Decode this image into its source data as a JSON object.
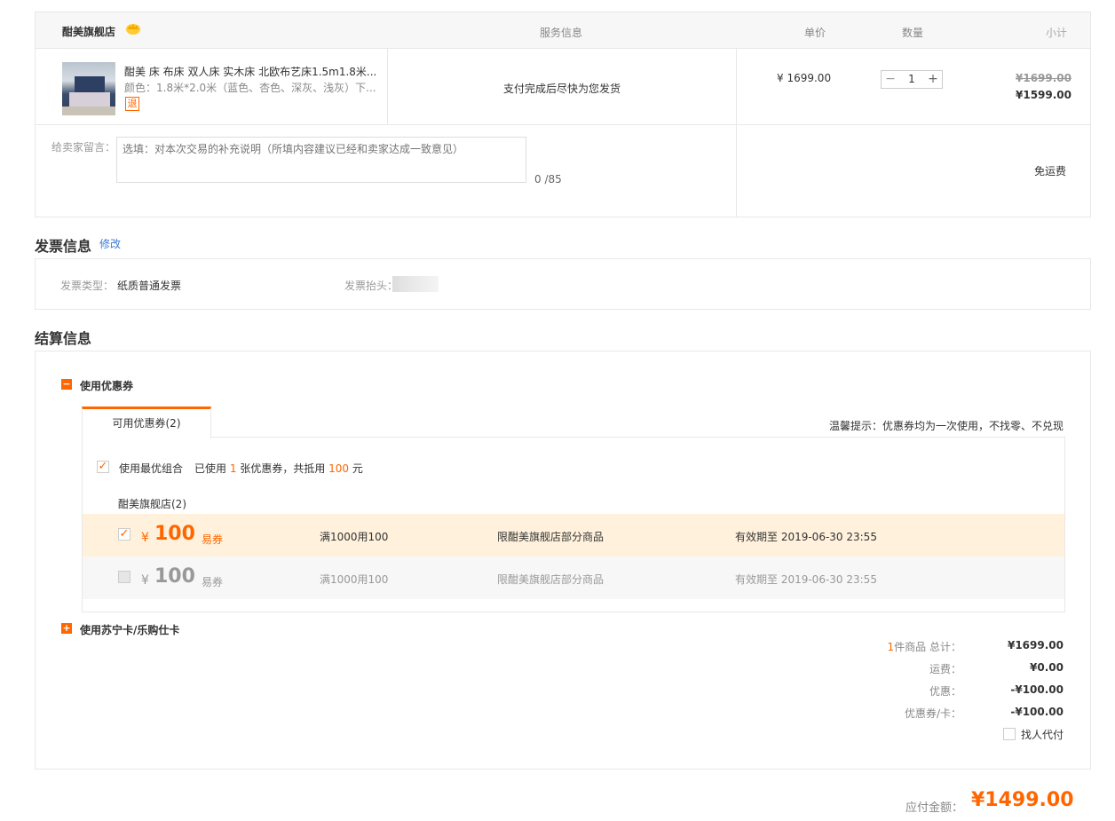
{
  "order": {
    "shop_name": "酣美旗舰店",
    "headers": {
      "service": "服务信息",
      "unit_price": "单价",
      "quantity": "数量",
      "subtotal": "小计"
    },
    "product": {
      "title": "酣美 床 布床 双人床 实木床 北欧布艺床1.5m1.8米...",
      "spec": "颜色：1.8米*2.0米（蓝色、杏色、深灰、浅灰）下...",
      "refund_tag": "退",
      "service": "支付完成后尽快为您发货",
      "unit_price": "¥ 1699.00",
      "quantity": "1",
      "original_subtotal": "¥1699.00",
      "subtotal": "¥1599.00"
    },
    "message_label": "给卖家留言：",
    "message_placeholder": "选填：对本次交易的补充说明（所填内容建议已经和卖家达成一致意见）",
    "message_count": "0 /85",
    "shipping": "免运费",
    "minus": "−",
    "plus": "+"
  },
  "invoice": {
    "title": "发票信息",
    "edit_link": "修改",
    "type_label": "发票类型：",
    "type_value": "纸质普通发票",
    "header_label": "发票抬头："
  },
  "settlement": {
    "title": "结算信息",
    "use_coupon": "使用优惠券",
    "tab_label": "可用优惠券(2)",
    "tip": "温馨提示：优惠券均为一次使用，不找零、不兑现",
    "best_combo": "使用最优组合",
    "used_prefix": "已使用",
    "used_count": "1",
    "used_mid": "张优惠券，共抵用",
    "used_amount": "100",
    "used_suffix": "元",
    "store_group": "酣美旗舰店(2)",
    "coupons": [
      {
        "currency": "¥",
        "amount": "100",
        "type": "易券",
        "rule": "满1000用100",
        "scope": "限酣美旗舰店部分商品",
        "expiry": "有效期至 2019-06-30 23:55",
        "checked": true
      },
      {
        "currency": "¥",
        "amount": "100",
        "type": "易券",
        "rule": "满1000用100",
        "scope": "限酣美旗舰店部分商品",
        "expiry": "有效期至 2019-06-30 23:55",
        "checked": false
      }
    ],
    "use_card": "使用苏宁卡/乐购仕卡",
    "summary": {
      "count": "1",
      "items_label": "件商品  总计：",
      "total": "¥1699.00",
      "shipping_label": "运费：",
      "shipping": "¥0.00",
      "discount_label": "优惠：",
      "discount": "-¥100.00",
      "coupon_label": "优惠券/卡：",
      "coupon": "-¥100.00",
      "proxy_pay": "找人代付"
    }
  },
  "payment": {
    "label": "应付金额：",
    "total": "¥1499.00"
  },
  "colors": {
    "accent": "#ff6600",
    "highlight_row": "#fff1dc",
    "muted_row": "#f7f7f7"
  }
}
